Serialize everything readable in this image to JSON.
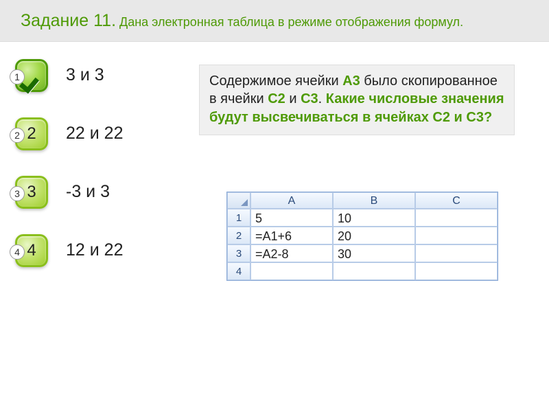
{
  "header": {
    "task_prefix": "Задание 11.",
    "title_rest": " Дана электронная таблица в режиме отображения формул."
  },
  "answers": [
    {
      "num": "1",
      "text": "3 и 3",
      "correct": true
    },
    {
      "num": "2",
      "text": "22 и 22",
      "correct": false
    },
    {
      "num": "3",
      "text": "-3 и 3",
      "correct": false
    },
    {
      "num": "4",
      "text": "12 и 22",
      "correct": false
    }
  ],
  "question": {
    "part1": "Содержимое ячейки ",
    "a3": "А3",
    "part2": " было скопированное в ячейки ",
    "c2": "С2",
    "part3": " и ",
    "c3a": "С3",
    "part4": ". ",
    "bold_tail_a": "Какие числовые значения будут высвечиваться в ячейках ",
    "c2b": "С2",
    "bold_tail_b": " и ",
    "c3b": "С3",
    "bold_tail_c": "?"
  },
  "chart_data": {
    "type": "table",
    "columns": [
      "A",
      "B",
      "C"
    ],
    "rows": [
      {
        "n": "1",
        "cells": [
          "5",
          "10",
          ""
        ]
      },
      {
        "n": "2",
        "cells": [
          "=A1+6",
          "20",
          ""
        ]
      },
      {
        "n": "3",
        "cells": [
          "=A2-8",
          "30",
          ""
        ]
      },
      {
        "n": "4",
        "cells": [
          "",
          "",
          ""
        ]
      }
    ]
  }
}
